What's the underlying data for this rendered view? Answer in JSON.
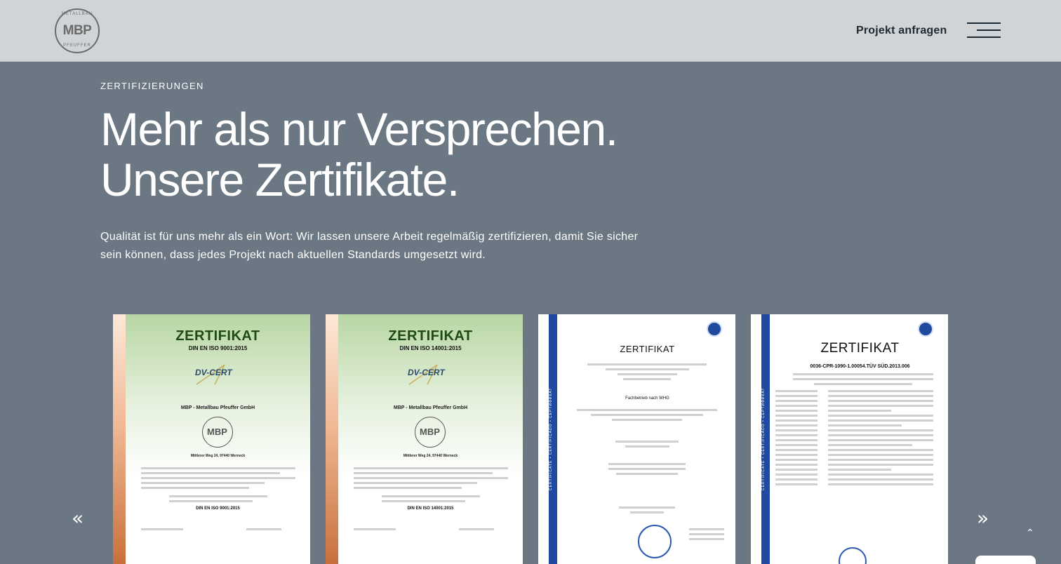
{
  "header": {
    "logo": {
      "top": "METALLBAU",
      "main": "MBP",
      "bottom": "PFEUFFER"
    },
    "cta_label": "Projekt anfragen",
    "menu_icon": "hamburger-menu-icon"
  },
  "section": {
    "eyebrow": "ZERTIFIZIERUNGEN",
    "headline_line1": "Mehr als nur Versprechen.",
    "headline_line2": "Unsere Zertifikate.",
    "intro": "Qualität ist für uns mehr als ein Wort: Wir lassen unsere Arbeit regelmäßig zertifizieren, damit Sie sicher sein können, dass jedes Projekt nach aktuellen Standards umgesetzt wird."
  },
  "carousel": {
    "prev_icon": "chevron-double-left-icon",
    "next_icon": "chevron-double-right-icon",
    "prev_glyph": "«",
    "next_glyph": "»",
    "certificates": [
      {
        "title": "ZERTIFIKAT",
        "norm": "DIN EN ISO 9001:2015",
        "issuer": "DV-CERT",
        "company": "MBP - Metallbau Pfeuffer GmbH",
        "address": "Mittlerer Weg 24, 97440 Werneck",
        "norm_footer": "DIN EN ISO 9001:2015"
      },
      {
        "title": "ZERTIFIKAT",
        "norm": "DIN EN ISO 14001:2015",
        "issuer": "DV-CERT",
        "company": "MBP - Metallbau Pfeuffer GmbH",
        "address": "Mittlerer Weg 24, 97440 Werneck",
        "norm_footer": "DIN EN ISO 14001:2015"
      },
      {
        "title": "ZERTIFIKAT",
        "subtitle": "Fachbetrieb nach WHG",
        "band": "CERTIFICATE • CERTIFICADO • CEPTИФИКAT"
      },
      {
        "title": "ZERTIFIKAT",
        "subtitle": "0036-CPR-1090-1.00054.TÜV SÜD.2013.006",
        "band": "CERTIFICATE • CERTIFICADO • CEPTИФИКAT"
      }
    ]
  },
  "scroll_top_glyph": "⌃",
  "colors": {
    "header_bg": "#d0d4d6",
    "section_bg": "#6b7782",
    "text_dark": "#1e2a33"
  }
}
